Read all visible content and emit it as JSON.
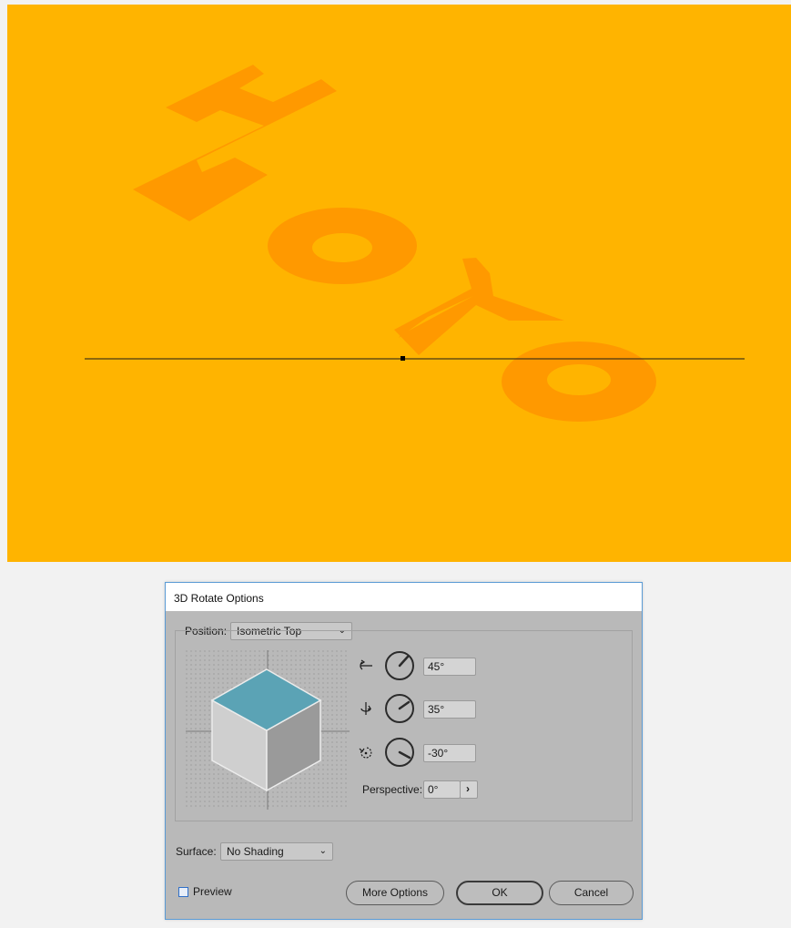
{
  "canvas": {
    "background": "#ffb400",
    "text": "HOYO",
    "text_color": "#ff9900"
  },
  "dialog": {
    "title": "3D Rotate Options",
    "position_label": "Position:",
    "position_value": "Isometric Top",
    "rotations": [
      {
        "axis": "x-axis-rotation-icon",
        "value": "45°"
      },
      {
        "axis": "y-axis-rotation-icon",
        "value": "35°"
      },
      {
        "axis": "z-axis-rotation-icon",
        "value": "-30°"
      }
    ],
    "perspective_label": "Perspective:",
    "perspective_value": "0°",
    "surface_label": "Surface:",
    "surface_value": "No Shading",
    "preview_label": "Preview",
    "preview_checked": false,
    "buttons": {
      "more_options": "More Options",
      "ok": "OK",
      "cancel": "Cancel"
    },
    "cube_colors": {
      "top": "#5ba3b5",
      "left": "#cfcfcf",
      "right": "#9a9a9a"
    }
  }
}
